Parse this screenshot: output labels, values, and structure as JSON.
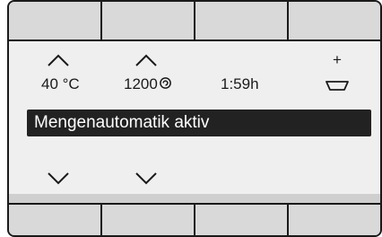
{
  "softkeys_top": [
    "",
    "",
    "",
    ""
  ],
  "softkeys_bottom": [
    "",
    "",
    "",
    ""
  ],
  "settings": {
    "temperature": {
      "value": "40 °C"
    },
    "spin_speed": {
      "value": "1200"
    },
    "duration": {
      "value": "1:59h"
    },
    "extra": {
      "plus_label": "+"
    }
  },
  "status_banner": {
    "text": "Mengenautomatik aktiv"
  },
  "icons": {
    "spin": "spin-spiral-icon",
    "cup": "detergent-cup-icon",
    "up": "chevron-up-icon",
    "down": "chevron-down-icon"
  },
  "colors": {
    "frame": "#1a1a1a",
    "key_background": "#d9d9d9",
    "display_background": "#efefef",
    "banner_background": "#222222",
    "banner_text": "#ffffff"
  }
}
